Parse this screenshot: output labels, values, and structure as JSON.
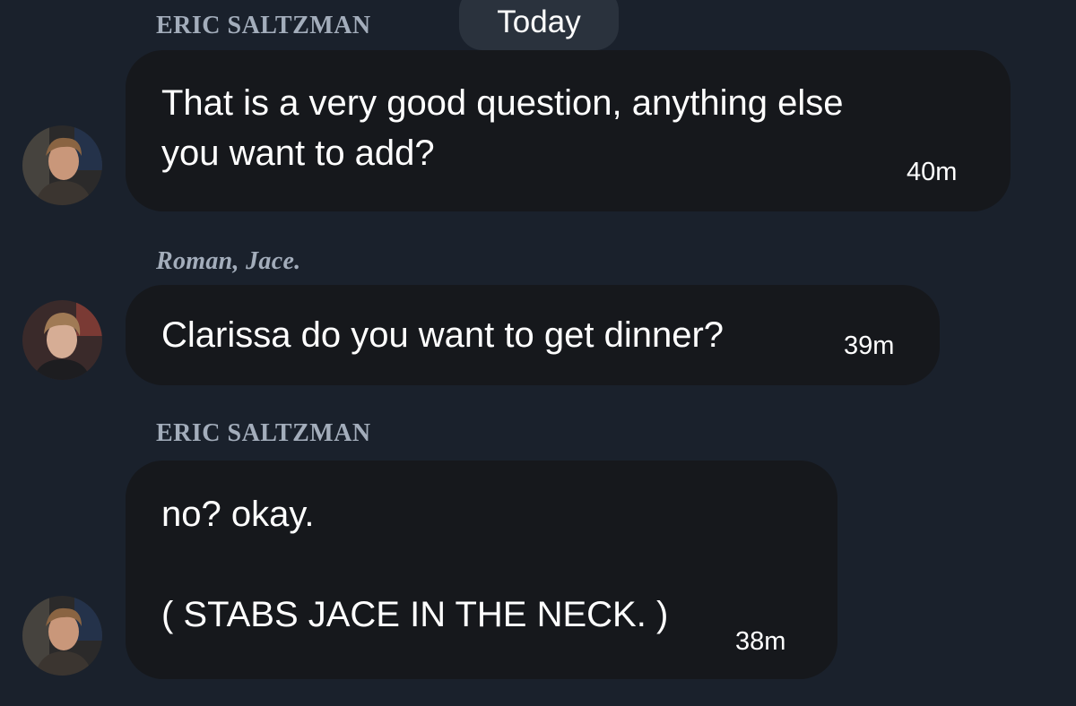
{
  "date_divider": "Today",
  "messages": [
    {
      "sender": "ERIC SALTZMAN",
      "text": "That is a very good question, anything else\nyou want to add?",
      "time": "40m"
    },
    {
      "sender": "Roman, Jace.",
      "text": "Clarissa do you want to get dinner?",
      "time": "39m"
    },
    {
      "sender": "ERIC SALTZMAN",
      "text": "no? okay.\n\n( STABS JACE IN THE NECK. )",
      "time": "38m"
    }
  ],
  "colors": {
    "background": "#1a212c",
    "bubble": "#16181c",
    "sender_name": "#a3adbb",
    "date_pill": "#2a323d"
  }
}
